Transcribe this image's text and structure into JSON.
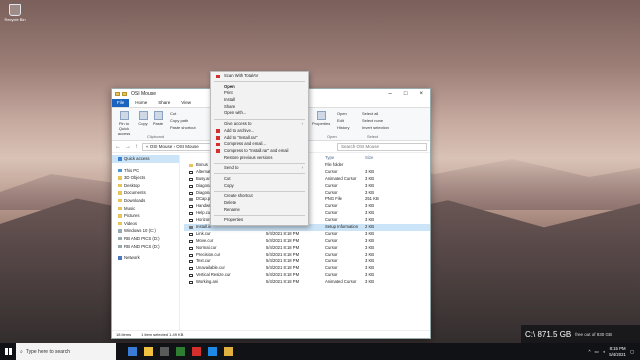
{
  "desktop": {
    "icon_label": "Recycle Bin"
  },
  "window": {
    "title": "OSI Mouse",
    "ribbon_tabs": [
      "File",
      "Home",
      "Share",
      "View"
    ],
    "ribbon": {
      "pin": "Pin to Quick access",
      "copy": "Copy",
      "paste": "Paste",
      "cut": "Cut",
      "copy_path": "Copy path",
      "paste_shortcut": "Paste shortcut",
      "clipboard": "Clipboard",
      "properties": "Properties",
      "open": "Open",
      "edit": "Edit",
      "history": "History",
      "open_group": "Open",
      "select_all": "Select all",
      "select_none": "Select none",
      "invert_selection": "Invert selection",
      "select_group": "Select"
    },
    "address": {
      "path": "« OSI Mouse › OSI Mouse",
      "search_placeholder": "Search OSI Mouse"
    },
    "columns": {
      "type": "Type",
      "size": "Size"
    },
    "nav": [
      {
        "label": "Quick access",
        "kind": "star",
        "sel": true
      },
      {
        "label": "",
        "kind": "gap"
      },
      {
        "label": "This PC",
        "kind": "pc"
      },
      {
        "label": "3D Objects",
        "kind": "fold"
      },
      {
        "label": "Desktop",
        "kind": "fold"
      },
      {
        "label": "Documents",
        "kind": "fold"
      },
      {
        "label": "Downloads",
        "kind": "fold"
      },
      {
        "label": "Music",
        "kind": "fold"
      },
      {
        "label": "Pictures",
        "kind": "fold"
      },
      {
        "label": "Videos",
        "kind": "fold"
      },
      {
        "label": "Windows 10 (C:)",
        "kind": "drv"
      },
      {
        "label": "RB AND PICS (D:)",
        "kind": "drv"
      },
      {
        "label": "RB AND PICS (D:)",
        "kind": "drv"
      },
      {
        "label": "",
        "kind": "gap"
      },
      {
        "label": "Network",
        "kind": "net"
      }
    ],
    "files": [
      {
        "name": "Bonus",
        "date": "",
        "type": "File folder",
        "size": "",
        "icon": "folder"
      },
      {
        "name": "Alternat",
        "date": "",
        "type": "Cursor",
        "size": "3 KB",
        "icon": "cur"
      },
      {
        "name": "Busy.ani",
        "date": "",
        "type": "Animated Cursor",
        "size": "3 KB",
        "icon": "cur"
      },
      {
        "name": "Diagonal",
        "date": "",
        "type": "Cursor",
        "size": "3 KB",
        "icon": "cur"
      },
      {
        "name": "Diagonal",
        "date": "",
        "type": "Cursor",
        "size": "3 KB",
        "icon": "cur"
      },
      {
        "name": "DCap.pn",
        "date": "",
        "type": "PNG File",
        "size": "251 KB",
        "icon": "file"
      },
      {
        "name": "Handwri",
        "date": "",
        "type": "Cursor",
        "size": "3 KB",
        "icon": "cur"
      },
      {
        "name": "Help.cur",
        "date": "",
        "type": "Cursor",
        "size": "3 KB",
        "icon": "cur"
      },
      {
        "name": "Horizont",
        "date": "",
        "type": "Cursor",
        "size": "3 KB",
        "icon": "cur"
      },
      {
        "name": "Install.in",
        "date": "",
        "type": "Setup Information",
        "size": "2 KB",
        "icon": "file",
        "sel": true
      },
      {
        "name": "Link.cur",
        "date": "5/4/2021 8:18 PM",
        "type": "Cursor",
        "size": "3 KB",
        "icon": "cur"
      },
      {
        "name": "Move.cur",
        "date": "5/4/2021 8:18 PM",
        "type": "Cursor",
        "size": "3 KB",
        "icon": "cur"
      },
      {
        "name": "Normal.cur",
        "date": "5/4/2021 8:18 PM",
        "type": "Cursor",
        "size": "3 KB",
        "icon": "cur"
      },
      {
        "name": "Precision.cur",
        "date": "5/4/2021 8:18 PM",
        "type": "Cursor",
        "size": "3 KB",
        "icon": "cur"
      },
      {
        "name": "Text.cur",
        "date": "5/4/2021 8:18 PM",
        "type": "Cursor",
        "size": "3 KB",
        "icon": "cur"
      },
      {
        "name": "Unavailable.cur",
        "date": "5/4/2021 8:18 PM",
        "type": "Cursor",
        "size": "3 KB",
        "icon": "cur"
      },
      {
        "name": "Vertical Resize.cur",
        "date": "5/4/2021 8:18 PM",
        "type": "Cursor",
        "size": "3 KB",
        "icon": "cur"
      },
      {
        "name": "Working.ani",
        "date": "5/4/2021 8:18 PM",
        "type": "Animated Cursor",
        "size": "3 KB",
        "icon": "cur"
      }
    ],
    "status": {
      "count": "18 items",
      "selected": "1 item selected  1.49 KB"
    }
  },
  "context_menu": [
    {
      "label": "Scan With TotalAV",
      "icon": true
    },
    {
      "sep": true
    },
    {
      "label": "Open",
      "bold": true
    },
    {
      "label": "Print"
    },
    {
      "label": "Install"
    },
    {
      "label": "Share"
    },
    {
      "label": "Open with..."
    },
    {
      "sep": true
    },
    {
      "label": "Give access to",
      "sub": true
    },
    {
      "label": "Add to archive...",
      "icon": true
    },
    {
      "label": "Add to \"Install.rar\"",
      "icon": true
    },
    {
      "label": "Compress and email...",
      "icon": true
    },
    {
      "label": "Compress to \"Install.rar\" and email",
      "icon": true
    },
    {
      "label": "Restore previous versions"
    },
    {
      "sep": true
    },
    {
      "label": "Send to",
      "sub": true
    },
    {
      "sep": true
    },
    {
      "label": "Cut"
    },
    {
      "label": "Copy"
    },
    {
      "sep": true
    },
    {
      "label": "Create shortcut"
    },
    {
      "label": "Delete"
    },
    {
      "label": "Rename"
    },
    {
      "sep": true
    },
    {
      "label": "Properties"
    }
  ],
  "drive_widget": {
    "label": "C:\\ 871.5 GB",
    "detail": "free out of 930 GB"
  },
  "taskbar": {
    "search_placeholder": "Type here to search",
    "time": "8:15 PM",
    "date": "5/4/2021",
    "app_colors": [
      "#3a7bd5",
      "#f0c040",
      "#5a5a5a",
      "#2e7d32",
      "#d32f2f",
      "#1e88e5",
      "#e0b040"
    ]
  }
}
